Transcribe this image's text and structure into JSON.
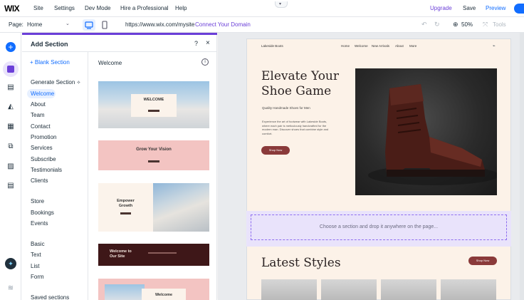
{
  "topbar": {
    "logo": "WIX",
    "menu": [
      "Site",
      "Settings",
      "Dev Mode",
      "Hire a Professional",
      "Help"
    ],
    "upgrade": "Upgrade",
    "save": "Save",
    "preview": "Preview"
  },
  "secondbar": {
    "page_label": "Page:",
    "page_value": "Home",
    "url": "https://www.wix.com/mysite",
    "connect": "Connect Your Domain",
    "zoom": "50%",
    "tools": "Tools"
  },
  "panel": {
    "title": "Add Section",
    "help": "?",
    "close": "×",
    "blank_section": "+ Blank Section",
    "generate": "Generate Section",
    "categories": [
      "Welcome",
      "About",
      "Team",
      "Contact",
      "Promotion",
      "Services",
      "Subscribe",
      "Testimonials",
      "Clients",
      "Store",
      "Bookings",
      "Events",
      "Basic",
      "Text",
      "List",
      "Form",
      "Saved sections"
    ],
    "selected_category": "Welcome",
    "category_header": "Welcome",
    "thumbnails": [
      {
        "label": "WELCOME"
      },
      {
        "label": "Grow Your Vision"
      },
      {
        "label": "Empower Growth"
      },
      {
        "label": "Welcome to Our Site"
      },
      {
        "label": "Welcome"
      }
    ]
  },
  "site": {
    "name": "Lakeside Boots",
    "nav": [
      "Home",
      "Welcome",
      "New Arrivals",
      "About",
      "More"
    ],
    "hero_title": "Elevate Your Shoe Game",
    "hero_subtitle": "Quality Handmade Shoes for Men",
    "hero_body": "Experience the art of footwear with Lakeside Boots, where each pair is meticulously handcrafted for the modern man. Discover shoes that combine style and comfort.",
    "hero_button": "Shop Now",
    "drop_text": "Choose a section and drop it anywhere on the page...",
    "latest_title": "Latest Styles",
    "latest_button": "Shop Now"
  },
  "colors": {
    "accent": "#116dff",
    "brand_purple": "#6b3fd8",
    "site_background": "#fcf2e8",
    "button": "#8a3a3a"
  }
}
